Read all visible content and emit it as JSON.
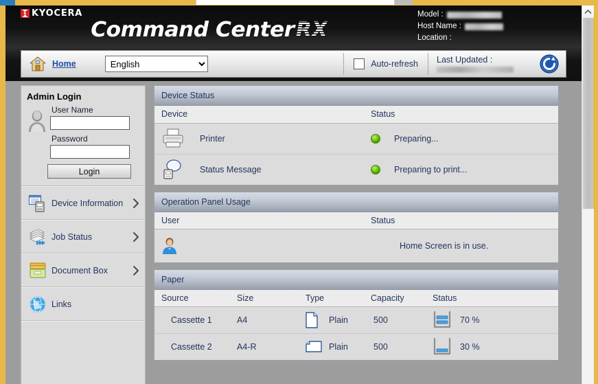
{
  "header": {
    "brand_word": "KYOCERA",
    "product_name": "Command Center",
    "product_suffix": "RX",
    "model_label": "Model :",
    "model_value": "",
    "host_label": "Host Name :",
    "host_value": "",
    "location_label": "Location :",
    "location_value": ""
  },
  "toolbar": {
    "home_label": "Home",
    "language_selected": "English",
    "language_options": [
      "English"
    ],
    "auto_refresh_label": "Auto-refresh",
    "auto_refresh_checked": false,
    "last_updated_label": "Last Updated :",
    "last_updated_value": "",
    "refresh_icon": "refresh-icon"
  },
  "sidebar": {
    "login": {
      "title": "Admin Login",
      "user_name_label": "User Name",
      "user_name_value": "",
      "password_label": "Password",
      "password_value": "",
      "login_button": "Login"
    },
    "items": [
      {
        "label": "Device Information",
        "icon": "device-information-icon",
        "chevron": true
      },
      {
        "label": "Job Status",
        "icon": "job-status-icon",
        "chevron": true
      },
      {
        "label": "Document Box",
        "icon": "document-box-icon",
        "chevron": true
      },
      {
        "label": "Links",
        "icon": "links-globe-icon",
        "chevron": false
      }
    ]
  },
  "panels": {
    "device_status": {
      "title": "Device Status",
      "columns": [
        "Device",
        "Status"
      ],
      "rows": [
        {
          "icon": "printer-icon",
          "device": "Printer",
          "led": "green",
          "status": "Preparing..."
        },
        {
          "icon": "status-message-icon",
          "device": "Status Message",
          "led": "green",
          "status": "Preparing to print..."
        }
      ]
    },
    "operation_panel_usage": {
      "title": "Operation Panel Usage",
      "columns": [
        "User",
        "Status"
      ],
      "rows": [
        {
          "icon": "user-icon",
          "user": "",
          "status": "Home Screen is in use."
        }
      ]
    },
    "paper": {
      "title": "Paper",
      "columns": [
        "Source",
        "Size",
        "Type",
        "Capacity",
        "Status"
      ],
      "rows": [
        {
          "source": "Cassette 1",
          "size": "A4",
          "type_icon": "paper-portrait-icon",
          "type": "Plain",
          "capacity": "500",
          "level_icon": "tray-level-icon",
          "level": "70 %",
          "level_pct": 70
        },
        {
          "source": "Cassette 2",
          "size": "A4-R",
          "type_icon": "paper-landscape-icon",
          "type": "Plain",
          "capacity": "500",
          "level_icon": "tray-level-icon",
          "level": "30 %",
          "level_pct": 30
        }
      ]
    }
  },
  "colors": {
    "header_bg": "#0b0b0b",
    "brand_red": "#d8232a",
    "link_blue": "#1d4fa6",
    "text_navy": "#22355c",
    "panel_bg": "#dcdcdc",
    "status_green": "#6ec80f",
    "window_border": "#e8b84b"
  }
}
